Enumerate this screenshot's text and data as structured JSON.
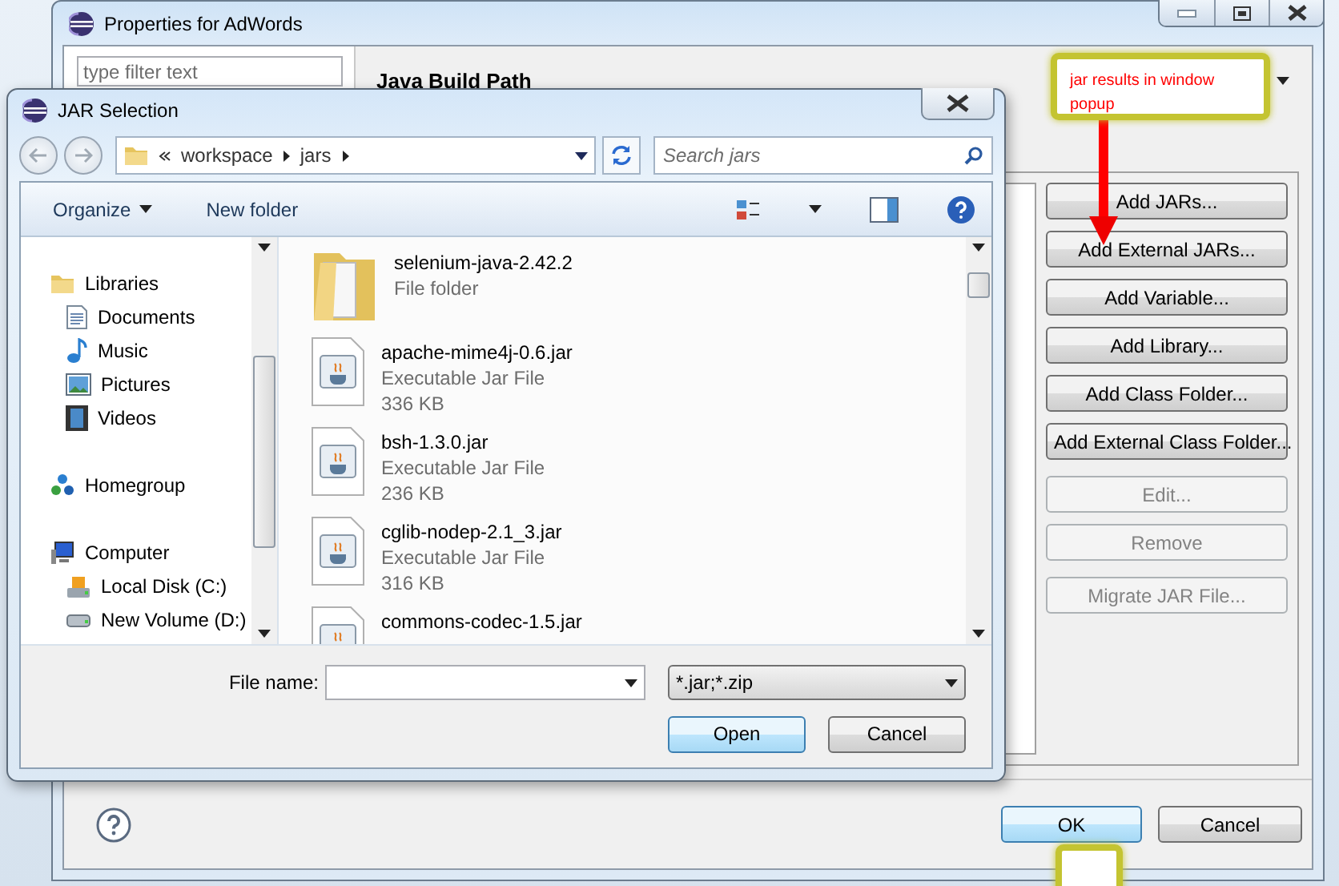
{
  "properties_window": {
    "title": "Properties for AdWords",
    "filter": {
      "placeholder": "type filter text"
    },
    "heading": "Java Build Path",
    "button_groups": [
      [
        {
          "label": "Add JARs...",
          "disabled": false
        },
        {
          "label": "Add External JARs...",
          "disabled": false
        },
        {
          "label": "Add Variable...",
          "disabled": false
        },
        {
          "label": "Add Library...",
          "disabled": false
        },
        {
          "label": "Add Class Folder...",
          "disabled": false
        },
        {
          "label": "Add External Class Folder...",
          "disabled": false
        }
      ],
      [
        {
          "label": "Edit...",
          "disabled": true
        },
        {
          "label": "Remove",
          "disabled": true
        }
      ],
      [
        {
          "label": "Migrate JAR File...",
          "disabled": true
        }
      ]
    ],
    "ok": "OK",
    "cancel": "Cancel"
  },
  "jar_dialog": {
    "title": "JAR Selection",
    "breadcrumb": [
      "workspace",
      "jars"
    ],
    "search": {
      "placeholder": "Search jars"
    },
    "toolbar": {
      "organize": "Organize",
      "new_folder": "New folder"
    },
    "nav_tree": [
      {
        "label": "Libraries",
        "kind": "libraries",
        "children": [
          {
            "label": "Documents",
            "kind": "documents"
          },
          {
            "label": "Music",
            "kind": "music"
          },
          {
            "label": "Pictures",
            "kind": "pictures"
          },
          {
            "label": "Videos",
            "kind": "videos"
          }
        ]
      },
      {
        "label": "Homegroup",
        "kind": "homegroup"
      },
      {
        "label": "Computer",
        "kind": "computer",
        "children": [
          {
            "label": "Local Disk (C:)",
            "kind": "disk"
          },
          {
            "label": "New Volume (D:)",
            "kind": "drive"
          }
        ]
      }
    ],
    "files": [
      {
        "kind": "folder",
        "name": "selenium-java-2.42.2",
        "type": "File folder"
      },
      {
        "kind": "jar",
        "name": "apache-mime4j-0.6.jar",
        "type": "Executable Jar File",
        "size": "336 KB"
      },
      {
        "kind": "jar",
        "name": "bsh-1.3.0.jar",
        "type": "Executable Jar File",
        "size": "236 KB"
      },
      {
        "kind": "jar",
        "name": "cglib-nodep-2.1_3.jar",
        "type": "Executable Jar File",
        "size": "316 KB"
      },
      {
        "kind": "jar",
        "name": "commons-codec-1.5.jar"
      }
    ],
    "file_name_label": "File name:",
    "file_type": "*.jar;*.zip",
    "open": "Open",
    "cancel": "Cancel"
  },
  "callout": {
    "text": "jar results in window popup"
  }
}
